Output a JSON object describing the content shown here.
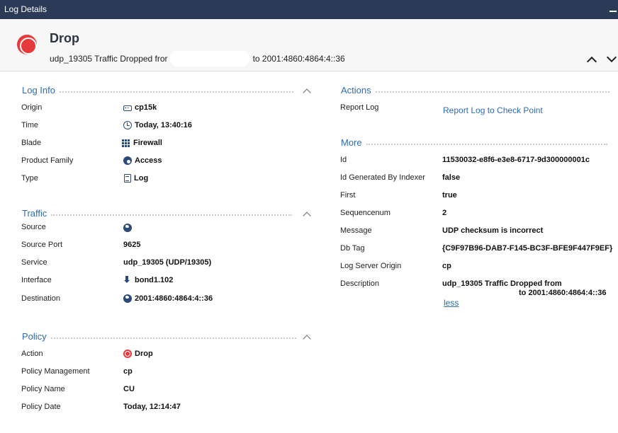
{
  "window": {
    "title": "Log Details"
  },
  "header": {
    "title": "Drop",
    "subtitle_prefix": "udp_19305 Traffic Dropped fror",
    "subtitle_suffix": "to 2001:4860:4864:4::36"
  },
  "colors": {
    "titlebar": "#2a3a57",
    "section_title": "#2e6bb0",
    "link": "#2e6bb0",
    "drop": "#e63a3a",
    "icon": "#2b4a7a"
  },
  "log_info": {
    "title": "Log Info",
    "rows": [
      {
        "label": "Origin",
        "value": "cp15k",
        "icon": "gateway-icon"
      },
      {
        "label": "Time",
        "value": "Today, 13:40:16",
        "icon": "clock-icon"
      },
      {
        "label": "Blade",
        "value": "Firewall",
        "icon": "firewall-icon"
      },
      {
        "label": "Product Family",
        "value": "Access",
        "icon": "access-icon"
      },
      {
        "label": "Type",
        "value": "Log",
        "icon": "log-icon"
      }
    ]
  },
  "traffic": {
    "title": "Traffic",
    "rows": [
      {
        "label": "Source",
        "value": "",
        "icon": "globe-icon"
      },
      {
        "label": "Source Port",
        "value": "9625"
      },
      {
        "label": "Service",
        "value": "udp_19305 (UDP/19305)"
      },
      {
        "label": "Interface",
        "value": "bond1.102",
        "icon": "inbound-arrow-icon"
      },
      {
        "label": "Destination",
        "value": "2001:4860:4864:4::36",
        "icon": "globe-icon"
      }
    ]
  },
  "policy": {
    "title": "Policy",
    "rows": [
      {
        "label": "Action",
        "value": "Drop",
        "icon": "drop-icon"
      },
      {
        "label": "Policy Management",
        "value": "cp"
      },
      {
        "label": "Policy Name",
        "value": "CU"
      },
      {
        "label": "Policy Date",
        "value": "Today, 12:14:47"
      }
    ]
  },
  "actions": {
    "title": "Actions",
    "label": "Report Log",
    "link": "Report Log to Check Point"
  },
  "more": {
    "title": "More",
    "rows": [
      {
        "label": "Id",
        "value": "11530032-e8f6-e3e8-6717-9d300000001c"
      },
      {
        "label": "Id Generated By Indexer",
        "value": "false"
      },
      {
        "label": "First",
        "value": "true"
      },
      {
        "label": "Sequencenum",
        "value": "2"
      },
      {
        "label": "Message",
        "value": "UDP checksum is incorrect"
      },
      {
        "label": "Db Tag",
        "value": "{C9F97B96-DAB7-F145-BC3F-BFE9F447F9EF}"
      },
      {
        "label": "Log Server Origin",
        "value": "cp"
      },
      {
        "label": "Description",
        "value_line1": "udp_19305 Traffic Dropped from",
        "value_line2": "to 2001:4860:4864:4::36"
      }
    ],
    "less_link": "less"
  }
}
